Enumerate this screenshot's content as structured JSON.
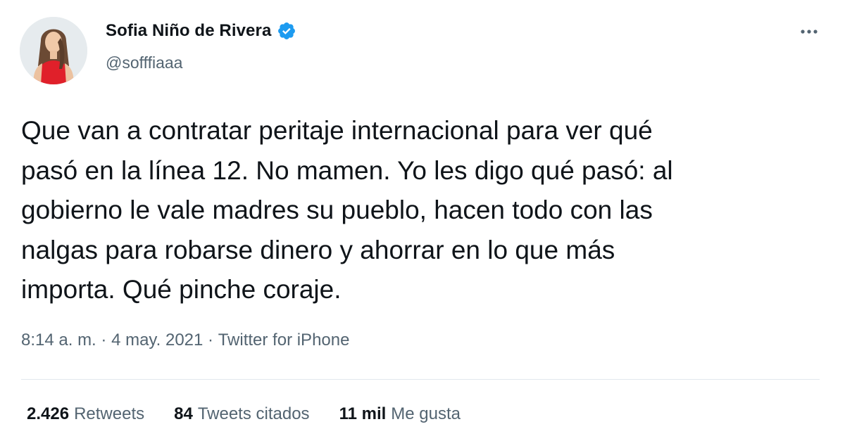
{
  "tweet": {
    "author": {
      "display_name": "Sofia Niño de Rivera",
      "handle": "@sofffiaaa",
      "verified": true,
      "avatar_icon": "profile-photo"
    },
    "more_icon": "more-options-icon",
    "text": "Que van a contratar peritaje internacional para ver qué\npasó en la línea 12. No mamen. Yo les digo qué pasó: al\ngobierno le vale madres su pueblo, hacen todo con las\nnalgas para robarse dinero y ahorrar en lo que más\nimporta. Qué pinche coraje.",
    "time": "8:14 a. m.",
    "separator": " · ",
    "date": "4 may. 2021",
    "source": "Twitter for iPhone",
    "stats": {
      "retweets_count": "2.426",
      "retweets_label": "Retweets",
      "quotes_count": "84",
      "quotes_label": "Tweets citados",
      "likes_count": "11 mil",
      "likes_label": "Me gusta"
    }
  },
  "colors": {
    "text_primary": "#0f1419",
    "text_secondary": "#536471",
    "verified_badge": "#1d9bf0",
    "divider": "#e1e8ed",
    "avatar_dress": "#e0202a"
  }
}
